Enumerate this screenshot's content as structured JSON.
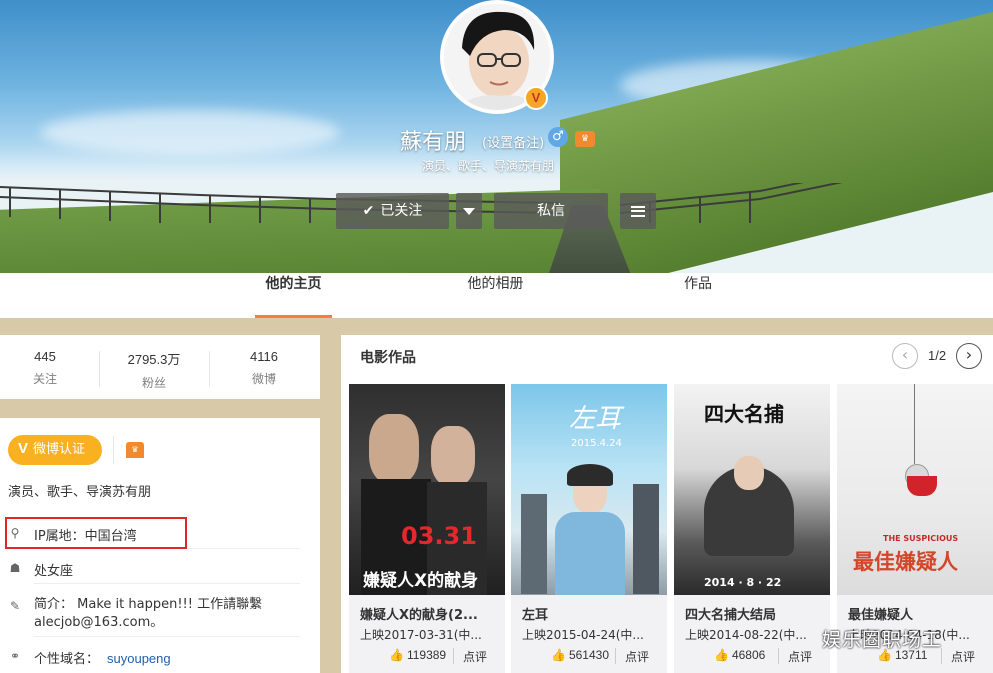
{
  "profile": {
    "username": "蘇有朋",
    "remark_label": "(设置备注)",
    "gender_icon": "male-icon",
    "bio": "演员、歌手、导演苏有朋",
    "avatar_badge": "V"
  },
  "actions": {
    "follow_label": "已关注",
    "message_label": "私信"
  },
  "tabs": [
    {
      "label": "他的主页",
      "active": true
    },
    {
      "label": "他的相册",
      "active": false
    },
    {
      "label": "作品",
      "active": false
    }
  ],
  "stats": [
    {
      "value": "445",
      "label": "关注"
    },
    {
      "value": "2795.3万",
      "label": "粉丝"
    },
    {
      "value": "4116",
      "label": "微博"
    }
  ],
  "info": {
    "verify_label": "微博认证",
    "verify_v": "V",
    "description": "演员、歌手、导演苏有朋",
    "ip_location": "IP属地：中国台湾",
    "zodiac": "处女座",
    "intro_label": "简介：",
    "intro_text": "Make it happen!!! 工作請聯繫",
    "intro_email": "alecjob@163.com。",
    "domain_label": "个性域名：",
    "domain_value": "suyoupeng"
  },
  "movies_section": {
    "title": "电影作品",
    "page": "1/2",
    "items": [
      {
        "name": "嫌疑人X的献身(2...",
        "date": "上映2017-03-31(中...",
        "likes": "119389",
        "rate": "点评",
        "poster_date": "03.31",
        "poster_title": "嫌疑人X的献身"
      },
      {
        "name": "左耳",
        "date": "上映2015-04-24(中...",
        "likes": "561430",
        "rate": "点评",
        "poster_date": "2015.4.24",
        "poster_title": "左耳"
      },
      {
        "name": "四大名捕大结局",
        "date": "上映2014-08-22(中...",
        "likes": "46806",
        "rate": "点评",
        "poster_date": "2014 · 8 · 22",
        "poster_title": "四大名捕"
      },
      {
        "name": "最佳嫌疑人",
        "date": "上映2014-04-18(中...",
        "likes": "13711",
        "rate": "点评",
        "poster_date": "THE SUSPICIOUS",
        "poster_title": "最佳嫌疑人"
      }
    ]
  },
  "watermark": "娱乐圈职场工",
  "colors": {
    "accent": "#fa7d3c",
    "verify": "#f9b122",
    "highlight_box": "#e0262a",
    "link": "#1f5fa8"
  }
}
